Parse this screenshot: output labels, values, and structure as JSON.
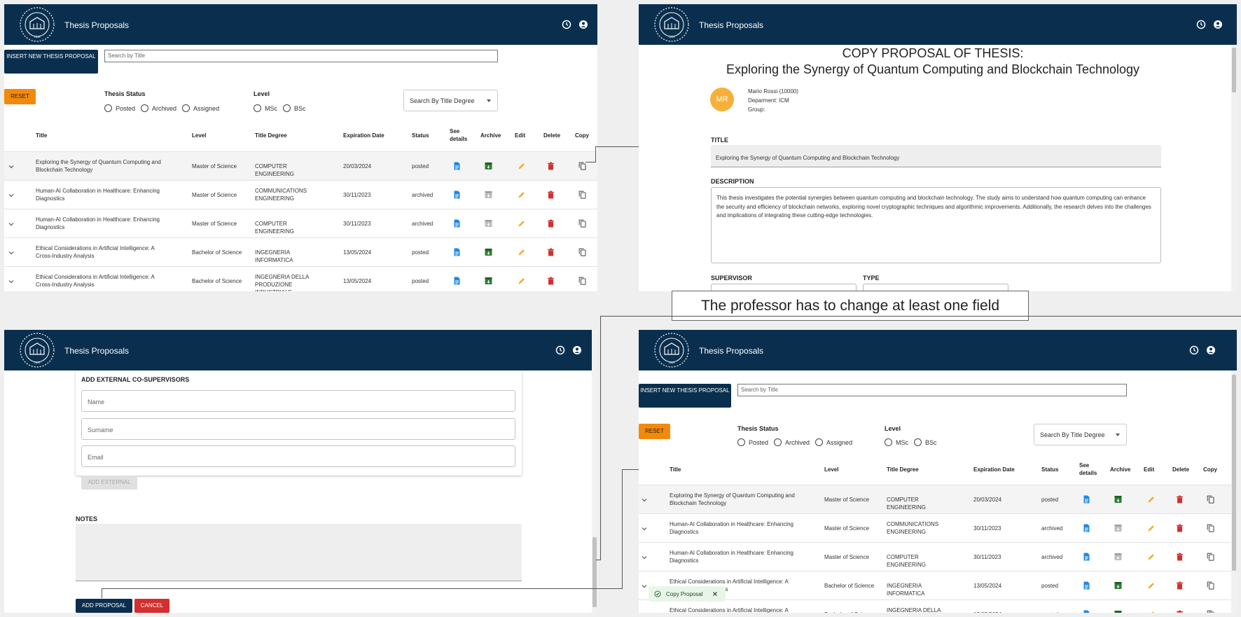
{
  "app": {
    "title": "Thesis Proposals",
    "logo_year": "1859"
  },
  "toolbar": {
    "insert_label": "INSERT NEW THESIS PROPOSAL",
    "search_placeholder": "Search by Title",
    "reset_label": "RESET",
    "status_label": "Thesis Status",
    "status_options": [
      "Posted",
      "Archived",
      "Assigned"
    ],
    "level_label": "Level",
    "level_options": [
      "MSc",
      "BSc"
    ],
    "degree_select": "Search By Title Degree"
  },
  "table": {
    "headers": [
      "Title",
      "Level",
      "Title Degree",
      "Expiration Date",
      "Status",
      "See details",
      "Archive",
      "Edit",
      "Delete",
      "Copy"
    ],
    "rows": [
      {
        "title": "Exploring the Synergy of Quantum Computing and Blockchain Technology",
        "level": "Master of Science",
        "degree": "COMPUTER ENGINEERING",
        "expiration": "20/03/2024",
        "status": "posted"
      },
      {
        "title": "Human-AI Collaboration in Healthcare: Enhancing Diagnostics",
        "level": "Master of Science",
        "degree": "COMMUNICATIONS ENGINEERING",
        "expiration": "30/11/2023",
        "status": "archived"
      },
      {
        "title": "Human-AI Collaboration in Healthcare: Enhancing Diagnostics",
        "level": "Master of Science",
        "degree": "COMPUTER ENGINEERING",
        "expiration": "30/11/2023",
        "status": "archived"
      },
      {
        "title": "Ethical Considerations in Artificial Intelligence: A Cross-Industry Analysis",
        "level": "Bachelor of Science",
        "degree": "INGEGNERIA INFORMATICA",
        "expiration": "13/05/2024",
        "status": "posted"
      },
      {
        "title": "Ethical Considerations in Artificial Intelligence: A Cross-Industry Analysis",
        "level": "Bachelor of Science",
        "degree": "INGEGNERIA DELLA PRODUZIONE INDUSTRIALE",
        "expiration": "13/05/2024",
        "status": "posted"
      }
    ]
  },
  "copy_page": {
    "heading": "COPY PROPOSAL OF THESIS:",
    "subheading": "Exploring the Synergy of Quantum Computing and Blockchain Technology",
    "avatar_initials": "MR",
    "prof_name": "Mario Rossi (10000)",
    "prof_department": "Deparment: ICM",
    "prof_group": "Group:",
    "title_label": "TITLE",
    "title_value": "Exploring the Synergy of Quantum Computing and Blockchain Technology",
    "description_label": "DESCRIPTION",
    "description_value": "This thesis investigates the potential synergies between quantum computing and blockchain technology. The study aims to understand how quantum computing can enhance the security and efficiency of blockchain networks, exploring novel cryptographic techniques and algorithmic improvements. Additionally, the research delves into the challenges and implications of integrating these cutting-edge technologies.",
    "supervisor_label": "SUPERVISOR",
    "type_label": "TYPE"
  },
  "callout": "The professor has to change at least one field",
  "form_bottom": {
    "external_label": "ADD EXTERNAL CO-SUPERVISORS",
    "name_placeholder": "Name",
    "surname_placeholder": "Surname",
    "email_placeholder": "Email",
    "add_external_label": "ADD EXTERNAL",
    "notes_label": "NOTES",
    "add_proposal_label": "ADD PROPOSAL",
    "cancel_label": "CANCEL"
  },
  "toast": {
    "message": "Copy Proposal"
  },
  "icons": {
    "history": "history-icon",
    "account": "account-icon",
    "details": "file-icon",
    "archive": "archive-icon",
    "edit": "pencil-icon",
    "delete": "trash-icon",
    "copy": "copy-icon"
  },
  "colors": {
    "primary": "#0a2f4e",
    "reset": "#f3890b",
    "details": "#1e88e5",
    "archive": "#2e7d32",
    "edit": "#f9a825",
    "delete": "#d32f2f"
  }
}
